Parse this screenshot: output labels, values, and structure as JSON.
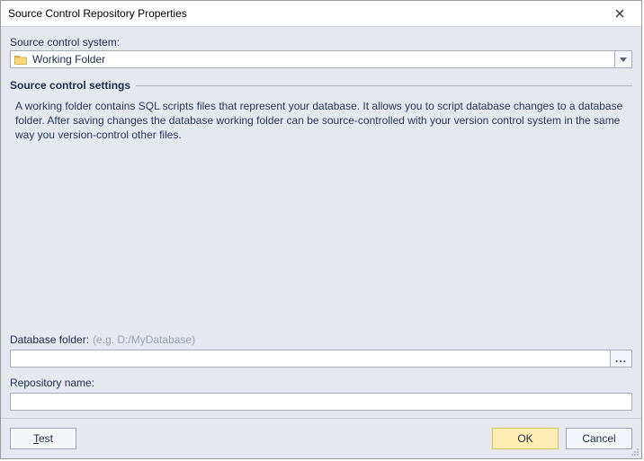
{
  "window": {
    "title": "Source Control Repository Properties"
  },
  "systemLabel": "Source control system:",
  "systemCombo": {
    "value": "Working Folder"
  },
  "settings": {
    "sectionTitle": "Source control settings",
    "description": "A working folder contains SQL scripts files that represent your database. It allows you to script database changes to a database folder. After saving changes the database working folder can be source-controlled with your version control system in the same way you version-control other files."
  },
  "dbFolder": {
    "label": "Database folder:",
    "hint": "(e.g. D:/MyDatabase)",
    "value": ""
  },
  "repoName": {
    "label": "Repository name:",
    "value": ""
  },
  "buttons": {
    "test": "Test",
    "ok": "OK",
    "cancel": "Cancel"
  },
  "browseEllipsis": "..."
}
